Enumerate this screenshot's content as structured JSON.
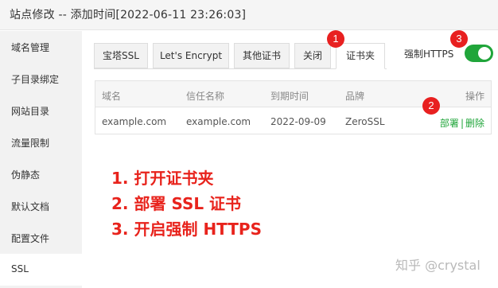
{
  "title": "站点修改 -- 添加时间[2022-06-11 23:26:03]",
  "sidebar": {
    "items": [
      {
        "label": "域名管理"
      },
      {
        "label": "子目录绑定"
      },
      {
        "label": "网站目录"
      },
      {
        "label": "流量限制"
      },
      {
        "label": "伪静态"
      },
      {
        "label": "默认文档"
      },
      {
        "label": "配置文件"
      },
      {
        "label": "SSL",
        "active": true
      }
    ]
  },
  "tabs": [
    {
      "label": "宝塔SSL"
    },
    {
      "label": "Let's Encrypt"
    },
    {
      "label": "其他证书"
    },
    {
      "label": "关闭"
    },
    {
      "label": "证书夹",
      "active": true
    }
  ],
  "force_https": {
    "label": "强制HTTPS",
    "enabled": true
  },
  "table": {
    "headers": [
      "域名",
      "信任名称",
      "到期时间",
      "品牌",
      "操作"
    ],
    "rows": [
      {
        "domain": "example.com",
        "trust_name": "example.com",
        "expiry": "2022-09-09",
        "brand": "ZeroSSL",
        "action_deploy": "部署",
        "action_sep": "|",
        "action_delete": "删除"
      }
    ]
  },
  "badges": [
    "1",
    "2",
    "3"
  ],
  "steps": [
    "1. 打开证书夹",
    "2. 部署 SSL 证书",
    "3. 开启强制 HTTPS"
  ],
  "watermark": "知乎 @crystal",
  "colors": {
    "accent": "#20a53a",
    "badge": "#e82020",
    "step_text": "#e8231c"
  }
}
